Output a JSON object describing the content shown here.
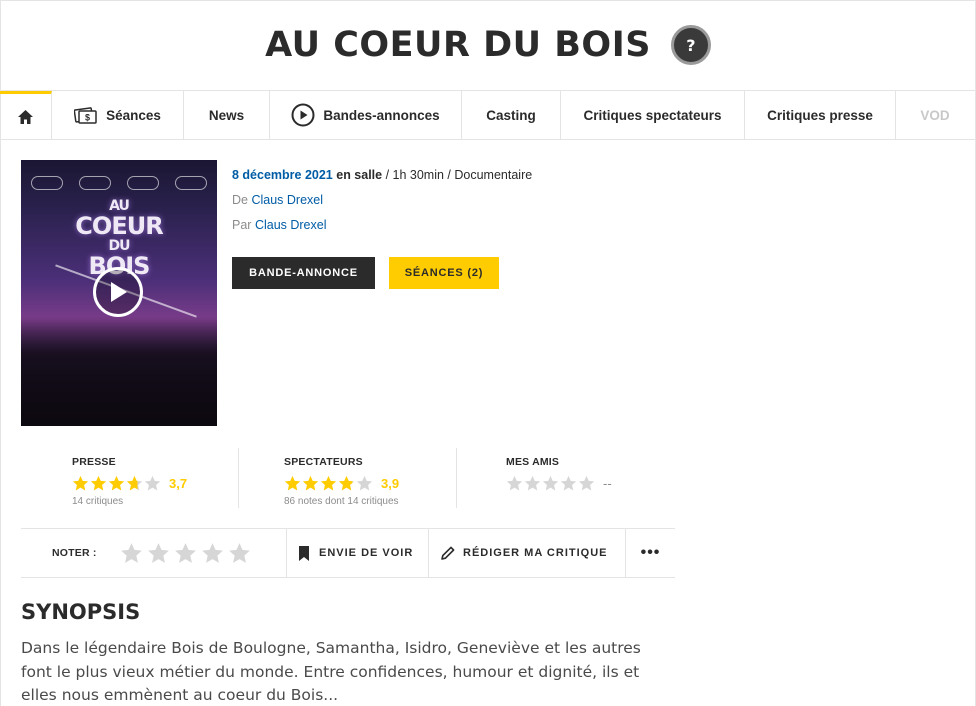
{
  "title": "AU COEUR DU BOIS",
  "help_icon": "?",
  "tabs": [
    {
      "label": "",
      "icon": "home-icon"
    },
    {
      "label": "Séances",
      "icon": "tickets-icon"
    },
    {
      "label": "News"
    },
    {
      "label": "Bandes-annonces",
      "icon": "play-circle-icon"
    },
    {
      "label": "Casting"
    },
    {
      "label": "Critiques spectateurs"
    },
    {
      "label": "Critiques presse"
    },
    {
      "label": "VOD"
    }
  ],
  "poster": {
    "title_line1": "AU",
    "title_line2": "COEUR",
    "title_line3": "DU",
    "title_line4": "BOIS",
    "play_icon": "play-icon"
  },
  "movie": {
    "date": "8 décembre 2021",
    "status": " en salle",
    "details": " / 1h 30min / Documentaire",
    "director_prefix": "De ",
    "director": "Claus Drexel",
    "writer_prefix": "Par ",
    "writer": "Claus Drexel"
  },
  "buttons": {
    "trailer": "BANDE-ANNONCE",
    "seances": "SÉANCES (2)"
  },
  "ratings": {
    "presse": {
      "label": "PRESSE",
      "value": "3,7",
      "score": 3.7,
      "sub": "14 critiques"
    },
    "spectateurs": {
      "label": "SPECTATEURS",
      "value": "3,9",
      "score": 3.9,
      "sub": "86 notes dont 14 critiques"
    },
    "amis": {
      "label": "MES AMIS",
      "value": "--",
      "score": 0
    }
  },
  "actions": {
    "noter_label": "NOTER :",
    "envie": "ENVIE DE VOIR",
    "rediger": "RÉDIGER MA CRITIQUE",
    "more": "•••"
  },
  "synopsis": {
    "title": "SYNOPSIS",
    "text": "Dans le légendaire Bois de Boulogne, Samantha, Isidro, Geneviève et les autres font le plus vieux métier du monde. Entre confidences, humour et dignité, ils et elles nous emmènent au coeur du Bois..."
  },
  "colors": {
    "accent": "#fecc00",
    "link": "#005ca5",
    "dark": "#2b2b2b",
    "muted": "#8c8c8c",
    "star_empty": "#d6d6d6"
  }
}
